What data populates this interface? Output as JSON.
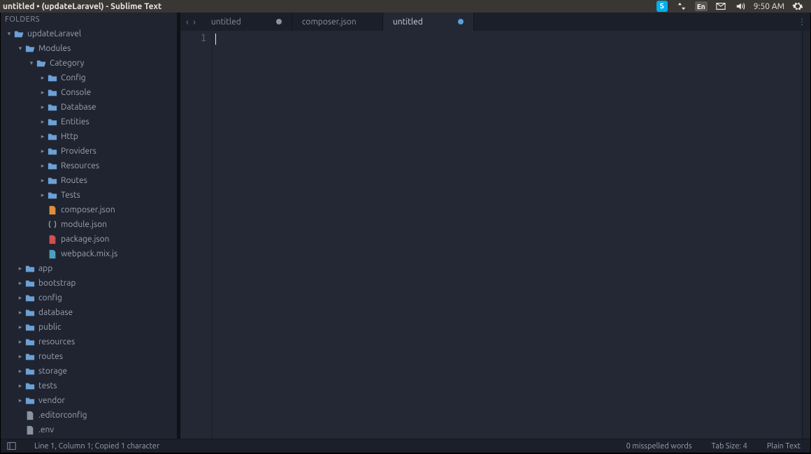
{
  "topbar": {
    "title": "untitled • (updateLaravel) - Sublime Text",
    "lang": "En",
    "clock": "9:50 AM"
  },
  "sidebar": {
    "header": "FOLDERS",
    "tree": [
      {
        "label": "updateLaravel",
        "depth": 0,
        "icon": "folder-open",
        "expandable": true,
        "expanded": true
      },
      {
        "label": "Modules",
        "depth": 1,
        "icon": "folder-open",
        "expandable": true,
        "expanded": true
      },
      {
        "label": "Category",
        "depth": 2,
        "icon": "folder-open",
        "expandable": true,
        "expanded": true
      },
      {
        "label": "Config",
        "depth": 3,
        "icon": "folder",
        "expandable": true,
        "expanded": false
      },
      {
        "label": "Console",
        "depth": 3,
        "icon": "folder",
        "expandable": true,
        "expanded": false
      },
      {
        "label": "Database",
        "depth": 3,
        "icon": "folder",
        "expandable": true,
        "expanded": false
      },
      {
        "label": "Entities",
        "depth": 3,
        "icon": "folder",
        "expandable": true,
        "expanded": false
      },
      {
        "label": "Http",
        "depth": 3,
        "icon": "folder",
        "expandable": true,
        "expanded": false
      },
      {
        "label": "Providers",
        "depth": 3,
        "icon": "folder",
        "expandable": true,
        "expanded": false
      },
      {
        "label": "Resources",
        "depth": 3,
        "icon": "folder",
        "expandable": true,
        "expanded": false
      },
      {
        "label": "Routes",
        "depth": 3,
        "icon": "folder",
        "expandable": true,
        "expanded": false
      },
      {
        "label": "Tests",
        "depth": 3,
        "icon": "folder",
        "expandable": true,
        "expanded": false
      },
      {
        "label": "composer.json",
        "depth": 3,
        "icon": "filecomposer",
        "expandable": false
      },
      {
        "label": "module.json",
        "depth": 3,
        "icon": "filejson",
        "expandable": false
      },
      {
        "label": "package.json",
        "depth": 3,
        "icon": "filepackage",
        "expandable": false
      },
      {
        "label": "webpack.mix.js",
        "depth": 3,
        "icon": "filewebpack",
        "expandable": false
      },
      {
        "label": "app",
        "depth": 1,
        "icon": "folder",
        "expandable": true,
        "expanded": false
      },
      {
        "label": "bootstrap",
        "depth": 1,
        "icon": "folder",
        "expandable": true,
        "expanded": false
      },
      {
        "label": "config",
        "depth": 1,
        "icon": "folder",
        "expandable": true,
        "expanded": false
      },
      {
        "label": "database",
        "depth": 1,
        "icon": "folder",
        "expandable": true,
        "expanded": false
      },
      {
        "label": "public",
        "depth": 1,
        "icon": "folder",
        "expandable": true,
        "expanded": false
      },
      {
        "label": "resources",
        "depth": 1,
        "icon": "folder",
        "expandable": true,
        "expanded": false
      },
      {
        "label": "routes",
        "depth": 1,
        "icon": "folder",
        "expandable": true,
        "expanded": false
      },
      {
        "label": "storage",
        "depth": 1,
        "icon": "folder",
        "expandable": true,
        "expanded": false
      },
      {
        "label": "tests",
        "depth": 1,
        "icon": "folder",
        "expandable": true,
        "expanded": false
      },
      {
        "label": "vendor",
        "depth": 1,
        "icon": "folder",
        "expandable": true,
        "expanded": false
      },
      {
        "label": ".editorconfig",
        "depth": 1,
        "icon": "filegeneric",
        "expandable": false
      },
      {
        "label": ".env",
        "depth": 1,
        "icon": "filegeneric",
        "expandable": false
      }
    ]
  },
  "tabs": [
    {
      "label": "untitled",
      "active": false,
      "dirty": true,
      "modified": false
    },
    {
      "label": "composer.json",
      "active": false,
      "dirty": false,
      "modified": false
    },
    {
      "label": "untitled",
      "active": true,
      "dirty": true,
      "modified": true
    }
  ],
  "editor": {
    "gutter_line": "1"
  },
  "statusbar": {
    "cursor": "Line 1, Column 1; Copied 1 character",
    "spell": "0 misspelled words",
    "tabsize": "Tab Size: 4",
    "syntax": "Plain Text"
  }
}
